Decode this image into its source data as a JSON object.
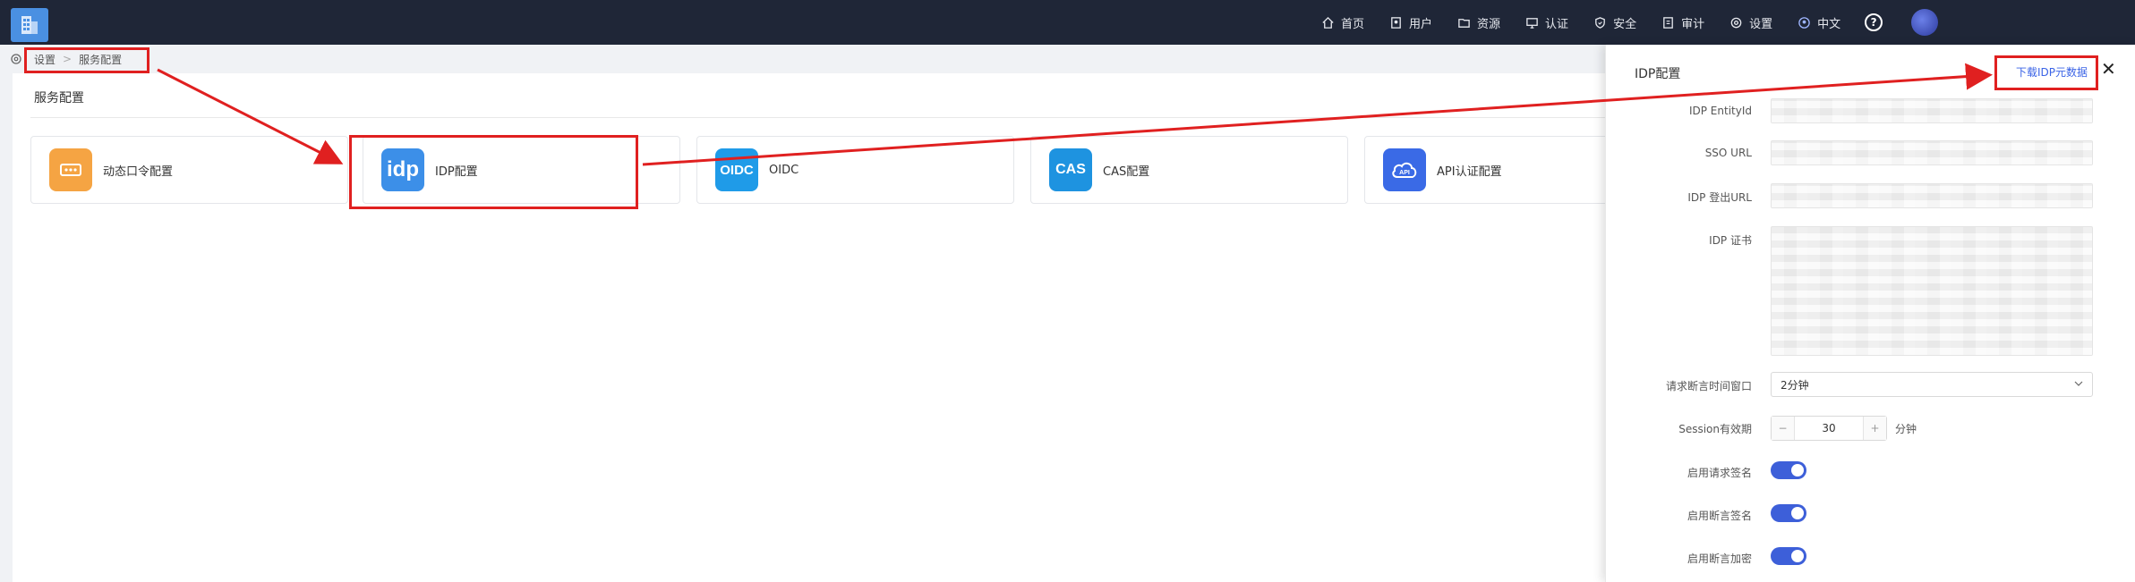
{
  "topbar": {
    "nav": [
      {
        "label": "首页",
        "icon": "home-icon"
      },
      {
        "label": "用户",
        "icon": "user-icon"
      },
      {
        "label": "资源",
        "icon": "folder-icon"
      },
      {
        "label": "认证",
        "icon": "monitor-icon"
      },
      {
        "label": "安全",
        "icon": "shield-icon"
      },
      {
        "label": "审计",
        "icon": "audit-icon"
      },
      {
        "label": "设置",
        "icon": "gear-icon"
      },
      {
        "label": "中文",
        "icon": "language-icon"
      }
    ],
    "help_label": "?"
  },
  "breadcrumb": {
    "items": [
      "设置",
      "服务配置"
    ],
    "separator": ">"
  },
  "page": {
    "title": "服务配置"
  },
  "cards": [
    {
      "label": "动态口令配置",
      "icon_text": "",
      "color": "#f5a443",
      "icon": "otp-icon"
    },
    {
      "label": "IDP配置",
      "icon_text": "idp",
      "color": "#3c8fe8",
      "icon": "idp-icon"
    },
    {
      "label": "OIDC",
      "icon_text": "OIDC",
      "color": "#1f9be8",
      "icon": "oidc-icon"
    },
    {
      "label": "CAS配置",
      "icon_text": "CAS",
      "color": "#1e93e0",
      "icon": "cas-icon"
    },
    {
      "label": "API认证配置",
      "icon_text": "API",
      "color": "#3a6ae6",
      "icon": "api-cloud-icon"
    }
  ],
  "drawer": {
    "title": "IDP配置",
    "download_link": "下载IDP元数据",
    "close": "✕",
    "fields": {
      "entity_id": "IDP EntityId",
      "sso_url": "SSO URL",
      "logout_url": "IDP 登出URL",
      "cert": "IDP 证书",
      "time_window": "请求断言时间窗口",
      "session": "Session有效期",
      "sign_request": "启用请求签名",
      "sign_assertion": "启用断言签名",
      "encrypt_assertion": "启用断言加密"
    },
    "time_window_value": "2分钟",
    "session_value": "30",
    "session_unit": "分钟",
    "minus": "−",
    "plus": "+",
    "toggles": {
      "sign_request": true,
      "sign_assertion": true,
      "encrypt_assertion": true
    }
  },
  "colors": {
    "topbar": "#1f2637",
    "accent": "#3d5fd9",
    "annotation": "#e02020"
  }
}
